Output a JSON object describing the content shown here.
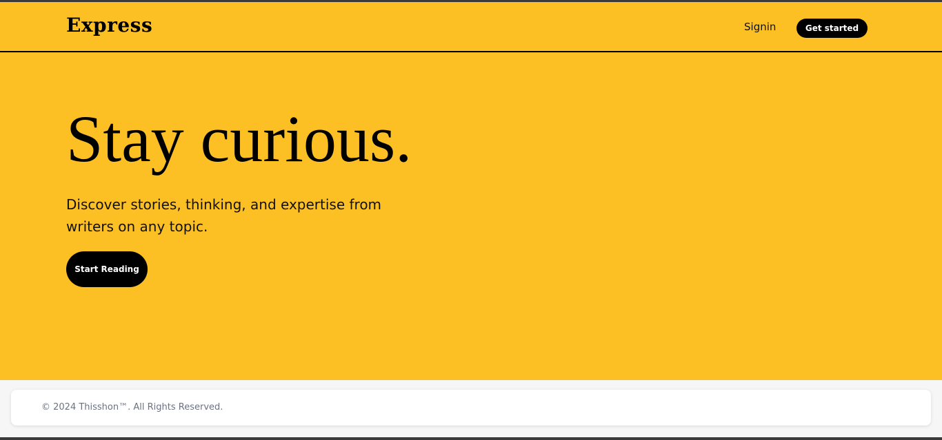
{
  "header": {
    "logo": "Express",
    "signin_label": "Signin",
    "get_started_label": "Get started"
  },
  "hero": {
    "title": "Stay curious.",
    "subtitle": "Discover stories, thinking, and expertise from writers on any topic.",
    "cta_label": "Start Reading"
  },
  "footer": {
    "copyright": "© 2024 Thisshon™. All Rights Reserved."
  },
  "colors": {
    "brand_yellow": "#fcc024",
    "button_black": "#000000",
    "footer_text": "#6b7280"
  }
}
